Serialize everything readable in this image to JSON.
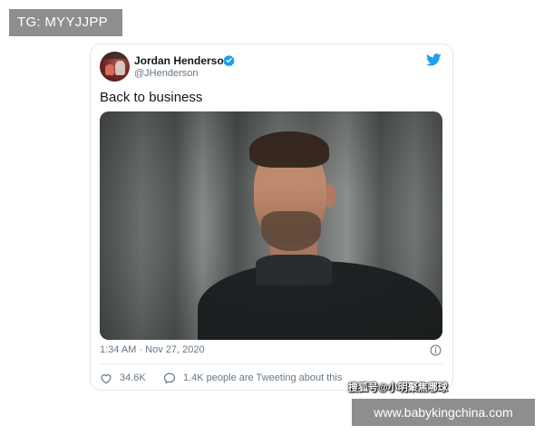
{
  "overlay": {
    "tg_label": "TG: MYYJJPP",
    "watermark_cn": "搜狐号@小明聚焦哪球",
    "watermark_site": "www.babykingchina.com"
  },
  "tweet": {
    "author_name": "Jordan Henderson",
    "author_handle": "@JHenderson",
    "verified": true,
    "text": "Back to business",
    "timestamp": "1:34 AM · Nov 27, 2020",
    "likes": "34.6K",
    "tweeting_text": "1.4K people are Tweeting about this",
    "icons": [
      "verified-badge-icon",
      "twitter-bird-icon",
      "info-icon",
      "heart-icon",
      "speech-bubble-icon"
    ]
  },
  "colors": {
    "twitter_blue": "#1da1f2",
    "text_primary": "#14171a",
    "text_secondary": "#657786",
    "overlay_gray": "#8e8e8e"
  }
}
